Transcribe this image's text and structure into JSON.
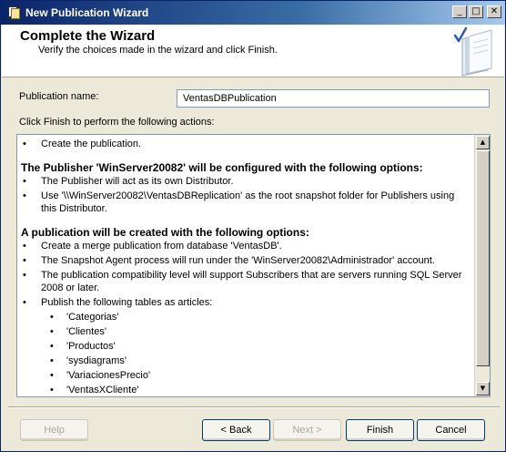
{
  "window": {
    "title": "New Publication Wizard"
  },
  "title_buttons": {
    "minimize": "_",
    "maximize": "□",
    "close": "✕"
  },
  "header": {
    "title": "Complete the Wizard",
    "subtitle": "Verify the choices made in the wizard and click Finish."
  },
  "publication": {
    "label": "Publication name:",
    "value": "VentasDBPublication"
  },
  "actions_label": "Click Finish to perform the following actions:",
  "report": {
    "bullet": "•",
    "create": "Create the publication.",
    "publisher_heading": "The Publisher 'WinServer20082' will be configured with the following options:",
    "publisher_items": [
      "The Publisher will act as its own Distributor.",
      "Use '\\\\WinServer20082\\VentasDBReplication' as the root snapshot folder for Publishers using this Distributor."
    ],
    "publication_heading": "A publication will be created with the following options:",
    "publication_items": [
      "Create a merge publication from database 'VentasDB'.",
      "The Snapshot Agent process will run under the 'WinServer20082\\Administrador' account.",
      "The publication compatibility level will support Subscribers that are servers running SQL Server 2008 or later.",
      "Publish the following tables as articles:"
    ],
    "articles": [
      "'Categorias'",
      "'Clientes'",
      "'Productos'",
      "'sysdiagrams'",
      "'VariacionesPrecio'",
      "'VentasXCliente'"
    ]
  },
  "scrollbar": {
    "up": "▲",
    "down": "▼"
  },
  "buttons": {
    "help": "Help",
    "back": "< Back",
    "next": "Next >",
    "finish": "Finish",
    "cancel": "Cancel"
  }
}
